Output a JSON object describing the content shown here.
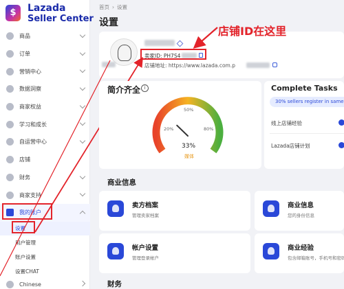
{
  "app": {
    "logo_line1": "Lazada",
    "logo_line2": "Seller Center"
  },
  "sidebar": {
    "items": [
      {
        "label": "商品"
      },
      {
        "label": "订单"
      },
      {
        "label": "营销中心"
      },
      {
        "label": "数据洞察"
      },
      {
        "label": "商家权益"
      },
      {
        "label": "学习和成长"
      },
      {
        "label": "自运营中心"
      },
      {
        "label": "店铺"
      },
      {
        "label": "财务"
      },
      {
        "label": "商家支持"
      },
      {
        "label": "我的账户"
      }
    ],
    "subitems": [
      {
        "label": "设置"
      },
      {
        "label": "用户管理"
      },
      {
        "label": "账户设置"
      },
      {
        "label": "设置CHAT"
      }
    ],
    "language": "Chinese"
  },
  "breadcrumb": {
    "home": "首页",
    "separator": "›",
    "current": "设置"
  },
  "page_title": "设置",
  "profile": {
    "seller_id": "卖家ID: PH7S4",
    "shop_url": "店铺地址: https://www.lazada.com.p"
  },
  "annotation": "店铺ID在这里",
  "completeness": {
    "title": "简介齐全",
    "info_glyph": "i",
    "percent": "33%",
    "label": "媒体",
    "ticks": {
      "t20": "20%",
      "t50": "50%",
      "t80": "80%"
    },
    "value": 0.33
  },
  "tasks": {
    "title": "Complete Tasks",
    "pill": "30% sellers register in same",
    "items": [
      {
        "label": "线上店铺经验"
      },
      {
        "label": "Lazada店铺计划"
      }
    ]
  },
  "business_info": {
    "title": "商业信息",
    "cards": [
      {
        "title": "卖方档案",
        "desc": "管理卖家档案"
      },
      {
        "title": "商业信息",
        "desc": "您的身份信息"
      },
      {
        "title": "帐户设置",
        "desc": "管理登录帐户"
      },
      {
        "title": "商业经验",
        "desc": "包含邮箱账号，手机号和密码"
      }
    ]
  },
  "finance": {
    "title": "财务"
  },
  "colors": {
    "accent": "#2a48d8",
    "annotation_red": "#e3232a"
  }
}
